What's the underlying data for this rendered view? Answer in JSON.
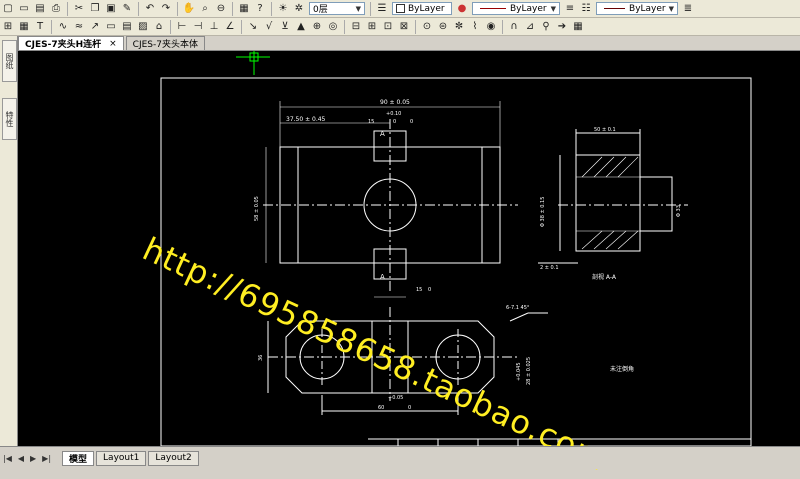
{
  "toolbar": {
    "layer_value": "0层",
    "color_value": "ByLayer",
    "linetype_value": "ByLayer",
    "lineweight_value": "ByLayer"
  },
  "tabs": [
    {
      "label": "CJES-7夹头H连杆",
      "close": "×"
    },
    {
      "label": "CJES-7夹头本体"
    }
  ],
  "side_panel": {
    "tab1": "图纸",
    "tab2": "特性"
  },
  "layout_tabs": [
    "模型",
    "Layout1",
    "Layout2"
  ],
  "nav_buttons": [
    "|◀",
    "◀",
    "▶",
    "▶|"
  ],
  "watermark": "http://695858658.taobao.com",
  "drawing": {
    "dim_top": "90 ± 0.05",
    "dim_offset": "37.50 ± 0.45",
    "dim_slot_top": "+0.10",
    "dim_slot_zero": "0",
    "dim_15a": "15",
    "dim_0a": "0",
    "dim_height": "58 ± 0.05",
    "dim_bottom_15": "15",
    "dim_bottom_0": "0",
    "section_a": "A",
    "section_a2": "A",
    "right_width": "50 ± 0.1",
    "right_dia": "Φ 38 ± 0.15",
    "right_dia2": "Φ 33",
    "right_bottom": "2 ± 0.1",
    "section_label": "剖视 A-A",
    "chamfer_note": "6-7.1  45°",
    "bottom_width": "60",
    "bottom_dim": "+0.05",
    "bottom_dim_zero": "0",
    "height_bottom": "36",
    "right_v1": "+0.045",
    "right_v2": "28 ± 0.025",
    "note": "未注倒角"
  }
}
